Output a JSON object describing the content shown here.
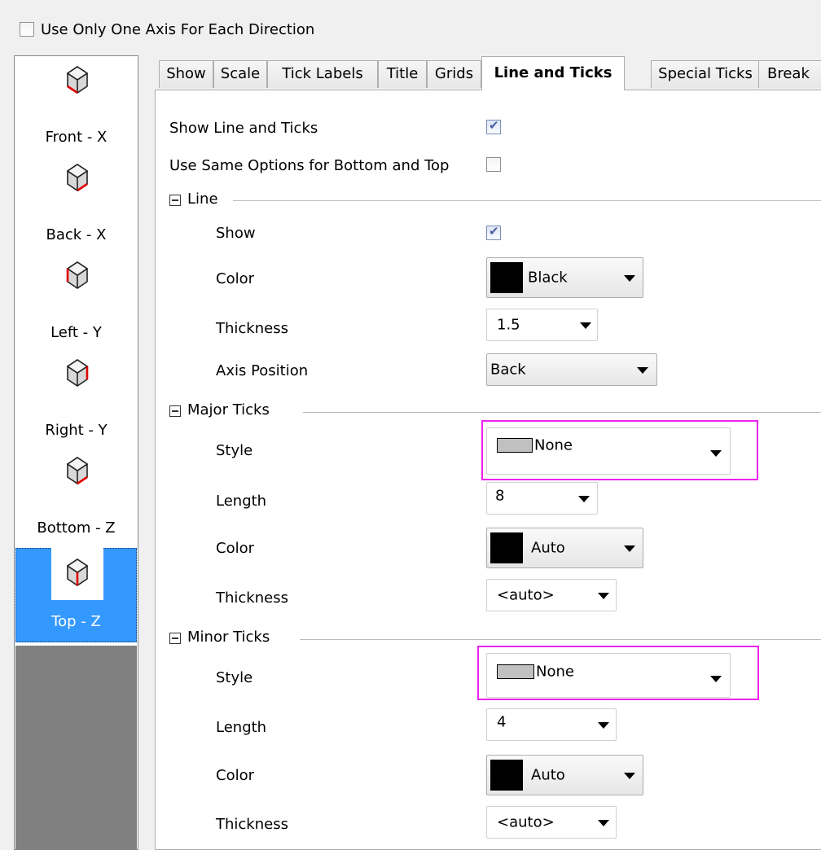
{
  "top_option": {
    "label": "Use Only One Axis For Each Direction",
    "checked": false
  },
  "sidebar": {
    "items": [
      {
        "label": "Front - X",
        "icon": "cube-front-x-icon",
        "selected": false
      },
      {
        "label": "Back - X",
        "icon": "cube-back-x-icon",
        "selected": false
      },
      {
        "label": "Left - Y",
        "icon": "cube-left-y-icon",
        "selected": false
      },
      {
        "label": "Right - Y",
        "icon": "cube-right-y-icon",
        "selected": false
      },
      {
        "label": "Bottom - Z",
        "icon": "cube-bottom-z-icon",
        "selected": false
      },
      {
        "label": "Top - Z",
        "icon": "cube-top-z-icon",
        "selected": true
      }
    ]
  },
  "tabs": [
    {
      "label": "Show",
      "active": false
    },
    {
      "label": "Scale",
      "active": false
    },
    {
      "label": "Tick Labels",
      "active": false
    },
    {
      "label": "Title",
      "active": false
    },
    {
      "label": "Grids",
      "active": false
    },
    {
      "label": "Line and Ticks",
      "active": true
    },
    {
      "label": "Special Ticks",
      "active": false
    },
    {
      "label": "Break",
      "active": false
    }
  ],
  "panel": {
    "show_line_ticks": {
      "label": "Show Line and Ticks",
      "checked": true
    },
    "same_options": {
      "label": "Use Same Options for Bottom and Top",
      "checked": false
    },
    "line": {
      "title": "Line",
      "show": {
        "label": "Show",
        "checked": true
      },
      "color": {
        "label": "Color",
        "value": "Black",
        "swatch": "#000000"
      },
      "thickness": {
        "label": "Thickness",
        "value": "1.5"
      },
      "axis_position": {
        "label": "Axis Position",
        "value": "Back"
      }
    },
    "major_ticks": {
      "title": "Major Ticks",
      "style": {
        "label": "Style",
        "value": "None"
      },
      "length": {
        "label": "Length",
        "value": "8"
      },
      "color": {
        "label": "Color",
        "value": "Auto",
        "swatch": "#000000"
      },
      "thickness": {
        "label": "Thickness",
        "value": "<auto>"
      }
    },
    "minor_ticks": {
      "title": "Minor Ticks",
      "style": {
        "label": "Style",
        "value": "None"
      },
      "length": {
        "label": "Length",
        "value": "4"
      },
      "color": {
        "label": "Color",
        "value": "Auto",
        "swatch": "#000000"
      },
      "thickness": {
        "label": "Thickness",
        "value": "<auto>"
      }
    }
  },
  "colors": {
    "highlight": "#ee22ee",
    "selection": "#3399ff",
    "sidebar_fill": "#808080"
  }
}
